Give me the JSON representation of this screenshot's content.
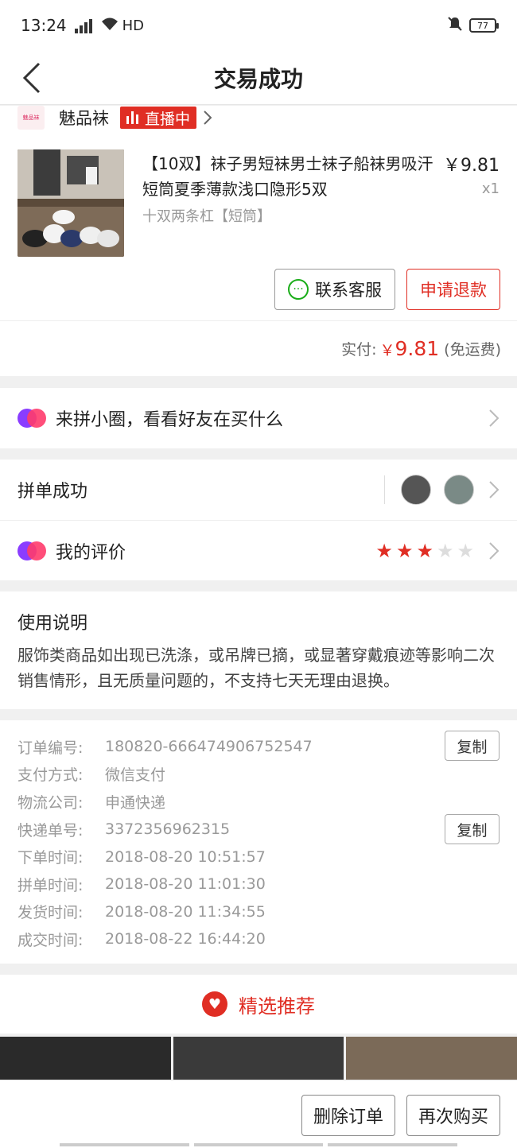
{
  "status": {
    "time": "13:24",
    "network": "4G",
    "hd": "HD",
    "battery": "77"
  },
  "header": {
    "title": "交易成功"
  },
  "shop": {
    "logo_text": "魅品袜",
    "name": "魅品袜",
    "live_label": "直播中"
  },
  "product": {
    "title": "【10双】袜子男短袜男士袜子船袜男吸汗短筒夏季薄款浅口隐形5双",
    "price": "￥9.81",
    "qty": "x1",
    "spec": "十双两条杠【短筒】"
  },
  "actions": {
    "contact": "联系客服",
    "refund": "申请退款"
  },
  "payment": {
    "label": "实付:",
    "currency": "￥",
    "amount": "9.81",
    "note": "(免运费)"
  },
  "circle": {
    "label": "来拼小圈，看看好友在买什么"
  },
  "group": {
    "label": "拼单成功"
  },
  "review": {
    "label": "我的评价",
    "rating": 3,
    "max": 5
  },
  "notes": {
    "title": "使用说明",
    "body": "服饰类商品如出现已洗涤，或吊牌已摘，或显著穿戴痕迹等影响二次销售情形，且无质量问题的，不支持七天无理由退换。"
  },
  "order_info": [
    {
      "key": "订单编号:",
      "value": "180820-666474906752547"
    },
    {
      "key": "支付方式:",
      "value": "微信支付"
    },
    {
      "key": "物流公司:",
      "value": "申通快递"
    },
    {
      "key": "快递单号:",
      "value": "3372356962315"
    },
    {
      "key": "下单时间:",
      "value": "2018-08-20 10:51:57"
    },
    {
      "key": "拼单时间:",
      "value": "2018-08-20 11:01:30"
    },
    {
      "key": "发货时间:",
      "value": "2018-08-20 11:34:55"
    },
    {
      "key": "成交时间:",
      "value": "2018-08-22 16:44:20"
    }
  ],
  "copy_label": "复制",
  "recommend": {
    "label": "精选推荐"
  },
  "bottom": {
    "delete": "删除订单",
    "rebuy": "再次购买"
  },
  "colors": {
    "accent": "#e02e24",
    "wechat": "#1aad19"
  }
}
